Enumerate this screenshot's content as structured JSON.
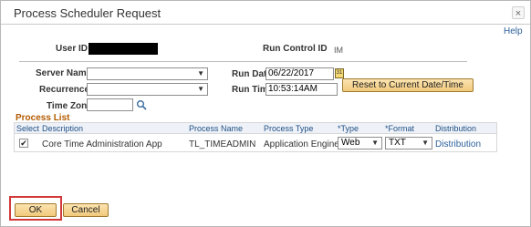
{
  "dialog": {
    "title": "Process Scheduler Request",
    "close_symbol": "×",
    "help_label": "Help"
  },
  "header": {
    "user_id_label": "User ID",
    "run_control_id_label": "Run Control ID",
    "run_control_id_value": "IM"
  },
  "form": {
    "server_name_label": "Server Name",
    "server_name_value": "",
    "recurrence_label": "Recurrence",
    "recurrence_value": "",
    "time_zone_label": "Time Zone",
    "time_zone_value": "",
    "run_date_label": "Run Date",
    "run_date_value": "06/22/2017",
    "run_time_label": "Run Time",
    "run_time_value": "10:53:14AM",
    "reset_button_label": "Reset to Current Date/Time"
  },
  "process_list": {
    "title": "Process List",
    "columns": [
      "Select",
      "Description",
      "Process Name",
      "Process Type",
      "*Type",
      "*Format",
      "Distribution"
    ],
    "rows": [
      {
        "selected": true,
        "description": "Core Time Administration App",
        "process_name": "TL_TIMEADMIN",
        "process_type": "Application Engine",
        "type": "Web",
        "format": "TXT",
        "distribution": "Distribution"
      }
    ]
  },
  "footer": {
    "ok_label": "OK",
    "cancel_label": "Cancel"
  },
  "colors": {
    "accent_orange": "#b35b00",
    "link_blue": "#2a5f99",
    "highlight_red": "#d23a3a"
  }
}
